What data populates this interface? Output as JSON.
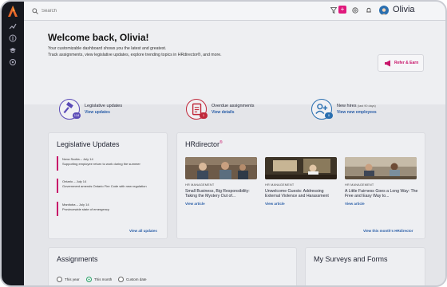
{
  "topbar": {
    "search_placeholder": "Search",
    "user_name": "Olivia"
  },
  "welcome": {
    "title": "Welcome back, Olivia!",
    "line1": "Your customizable dashboard shows you the latest and greatest.",
    "line2": "Track assignments, view legislative updates, explore trending topics in HRdirector®, and more.",
    "refer_label": "Refer & Earn"
  },
  "stats": [
    {
      "title": "Legislative updates",
      "note": "",
      "link": "View updates",
      "badge": "118",
      "color": "#5b4bb7"
    },
    {
      "title": "Overdue assignments",
      "note": "",
      "link": "View details",
      "badge": "1",
      "color": "#c0283a"
    },
    {
      "title": "New hires",
      "note": "(last 90 days)",
      "link": "View new employees",
      "badge": "0",
      "color": "#2a6fb0"
    }
  ],
  "legislative": {
    "title": "Legislative Updates",
    "items": [
      {
        "head": "Nova Scotia – July 14",
        "desc": "Supporting employee return to work during the summer"
      },
      {
        "head": "Ontario – July 14",
        "desc": "Government amends Ontario Fire Code with new regulation"
      },
      {
        "head": "Manitoba – July 14",
        "desc": "Provincewide state of emergency"
      }
    ],
    "view_all": "View all updates"
  },
  "hrdirector": {
    "title": "HRdirector",
    "mark": "®",
    "articles": [
      {
        "category": "HR MANAGEMENT",
        "title": "Small Business, Big Responsibility: Taking the Mystery Out of...",
        "link": "View article"
      },
      {
        "category": "HR MANAGEMENT",
        "title": "Unwelcome Guests: Addressing External Violence and Harassment",
        "link": "View article"
      },
      {
        "category": "HR MANAGEMENT",
        "title": "A Little Fairness Goes a Long Way: The Free and Easy Way to...",
        "link": "View article"
      }
    ],
    "view_all": "View this month's HRdirector"
  },
  "assignments": {
    "title": "Assignments",
    "filters": [
      {
        "label": "This year",
        "selected": false
      },
      {
        "label": "This month",
        "selected": true
      },
      {
        "label": "Custom date",
        "selected": false
      }
    ]
  },
  "surveys": {
    "title": "My Surveys and Forms"
  },
  "colors": {
    "accent": "#e0197d",
    "link": "#2a5ea8",
    "rail": "#16181f"
  }
}
